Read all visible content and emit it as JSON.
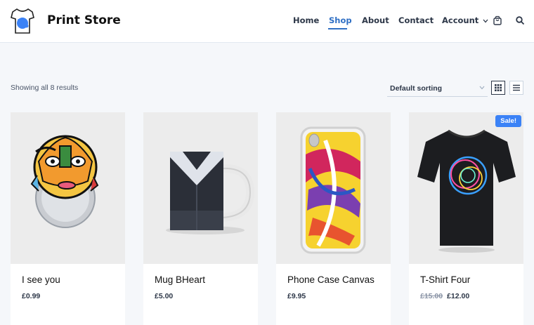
{
  "brand": {
    "name": "Print Store"
  },
  "nav": {
    "items": [
      "Home",
      "Shop",
      "About",
      "Contact",
      "Account"
    ],
    "active": "Shop"
  },
  "toolbar": {
    "result_count": "Showing all 8 results",
    "sort": {
      "selected": "Default sorting"
    },
    "views": [
      "grid-view-icon",
      "list-view-icon"
    ],
    "active_view": "grid"
  },
  "products": [
    {
      "title": "I see you",
      "price": "£0.99"
    },
    {
      "title": "Mug BHeart",
      "price": "£5.00"
    },
    {
      "title": "Phone Case Canvas",
      "price": "£9.95"
    },
    {
      "title": "T-Shirt Four",
      "old_price": "£15.00",
      "price": "£12.00",
      "badge": "Sale!"
    }
  ],
  "colors": {
    "accent": "#2f6fc4",
    "badge": "#3b82f6",
    "background": "#f5f7fa"
  }
}
